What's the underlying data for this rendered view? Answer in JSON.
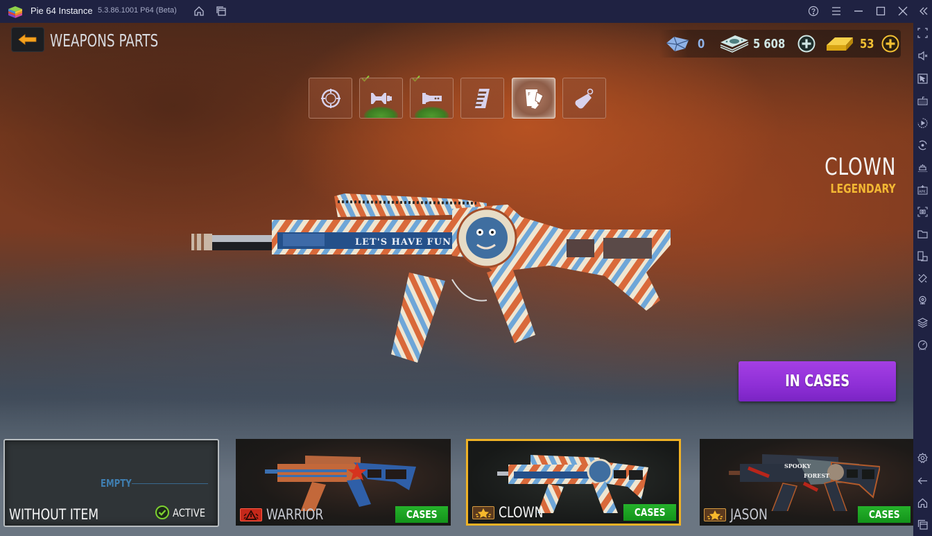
{
  "window": {
    "app_name": "Pie 64 Instance",
    "version": "5.3.86.1001 P64 (Beta)",
    "icons": [
      "home-icon",
      "multi-instance-icon",
      "help-icon",
      "menu-icon",
      "minimize-icon",
      "maximize-icon",
      "close-icon",
      "collapse-sidebar-icon"
    ]
  },
  "sidebar": {
    "icons": [
      "fullscreen-icon",
      "volume-mute-icon",
      "pointer-icon",
      "keyboard-icon",
      "macro-play-icon",
      "rotate-icon",
      "build-icon",
      "install-apk-icon",
      "screenshot-icon",
      "folder-icon",
      "multi-window-icon",
      "eco-mode-icon",
      "location-icon",
      "layers-icon",
      "performance-icon",
      "settings-icon",
      "back-icon",
      "home-icon",
      "recent-apps-icon"
    ]
  },
  "header": {
    "back_label": "back",
    "title": "WEAPONS PARTS"
  },
  "currency": {
    "tickets": {
      "icon": "ticket-icon",
      "value": "0",
      "color": "#8fb2e6"
    },
    "cash": {
      "icon": "cash-icon",
      "value": "5 608",
      "color": "#bfe0de"
    },
    "gold": {
      "icon": "gold-bar-icon",
      "value": "53",
      "color": "#f2c033"
    }
  },
  "part_tabs": [
    {
      "name": "scope",
      "icon": "scope-icon",
      "equipped": false,
      "selected": false
    },
    {
      "name": "muzzle",
      "icon": "muzzle-icon",
      "equipped": true,
      "selected": false
    },
    {
      "name": "flashlight",
      "icon": "flashlight-icon",
      "equipped": true,
      "selected": false
    },
    {
      "name": "magazine",
      "icon": "magazine-icon",
      "equipped": false,
      "selected": false
    },
    {
      "name": "skin",
      "icon": "paint-skin-icon",
      "equipped": false,
      "selected": true
    },
    {
      "name": "sticker",
      "icon": "tag-icon",
      "equipped": false,
      "selected": false
    }
  ],
  "item": {
    "name": "CLOWN",
    "rarity": "LEGENDARY",
    "rarity_color": "#f2b733",
    "weapon_text": "LET'S HAVE FUN"
  },
  "primary_action": {
    "label": "IN CASES",
    "color": "#9333dc"
  },
  "skins": [
    {
      "name": "WITHOUT ITEM",
      "type": "empty",
      "slot_label": "EMPTY",
      "status": "ACTIVE"
    },
    {
      "name": "WARRIOR",
      "type": "skin",
      "rarity": "epic-red",
      "action": "CASES",
      "selected": false
    },
    {
      "name": "CLOWN",
      "type": "skin",
      "rarity": "legendary-gold",
      "action": "CASES",
      "selected": true
    },
    {
      "name": "JASON",
      "type": "skin",
      "rarity": "legendary-gold",
      "action": "CASES",
      "selected": false,
      "weapon_text": [
        "SPOOKY",
        "FOREST"
      ]
    }
  ]
}
